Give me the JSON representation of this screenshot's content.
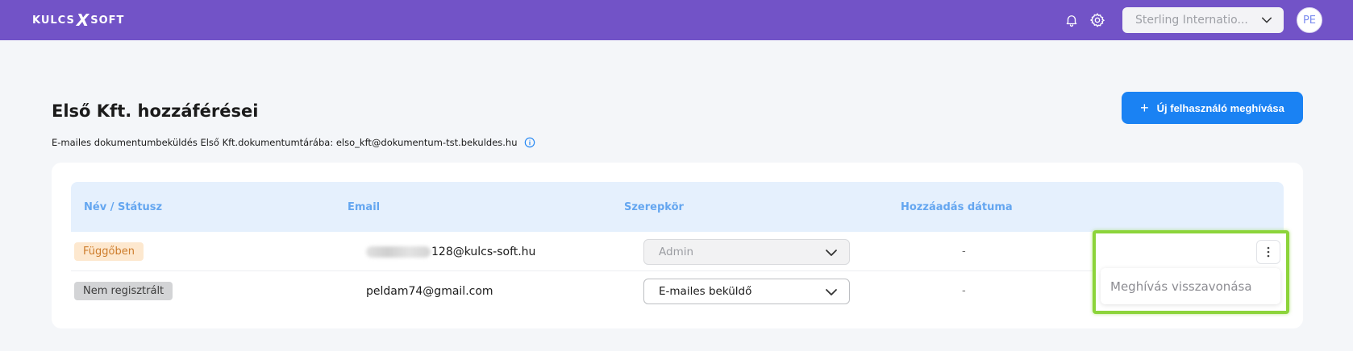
{
  "topbar": {
    "logo_left": "KULCS",
    "logo_x": "X",
    "logo_right": "SOFT",
    "company_selector": "Sterling Internatio...",
    "avatar_initials": "PE",
    "icons": {
      "bell": "bell-icon",
      "settings": "gear-icon",
      "dropdown": "chevron-down-icon"
    }
  },
  "page": {
    "title": "Első Kft. hozzáférései",
    "subtitle": "E-mailes dokumentumbeküldés Első Kft.dokumentumtárába: elso_kft@dokumentum-tst.bekuldes.hu",
    "invite_button": "Új felhasználó meghívása"
  },
  "table": {
    "columns": [
      "Név / Státusz",
      "Email",
      "Szerepkör",
      "Hozzáadás dátuma"
    ],
    "rows": [
      {
        "status": "Függőben",
        "email_visible": "128@kulcs-soft.hu",
        "role": "Admin",
        "date": "-"
      },
      {
        "status": "Nem regisztrált",
        "email_visible": "peldam74@gmail.com",
        "role": "E-mailes beküldő",
        "date": "-"
      }
    ]
  },
  "context_menu": {
    "items": [
      "Meghívás visszavonása"
    ]
  },
  "colors": {
    "topbar": "#7253c7",
    "primary": "#1a82f3",
    "header_bg": "#e5f0fd",
    "header_text": "#64a6f0",
    "pending_bg": "#fde8cf",
    "pending_text": "#cd7c2b",
    "highlight": "#8cd43a"
  }
}
